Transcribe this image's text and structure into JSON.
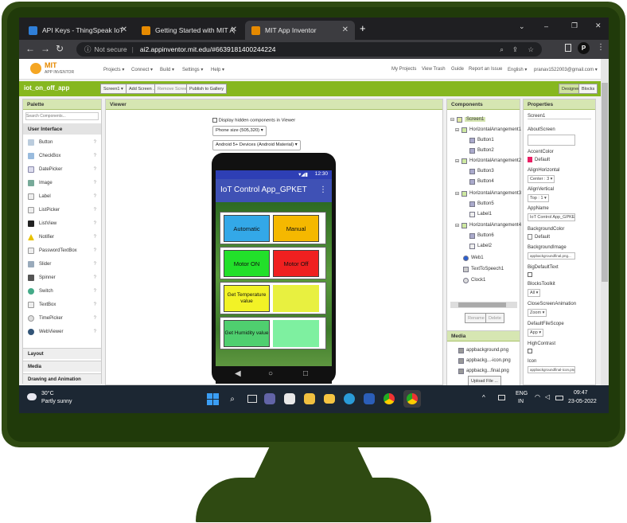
{
  "tabs": [
    {
      "title": "API Keys - ThingSpeak IoT",
      "close": "✕",
      "color": "#2f7fd8"
    },
    {
      "title": "Getting Started with MIT App In",
      "close": "✕",
      "color": "#e68a00"
    },
    {
      "title": "MIT App Inventor",
      "close": "✕",
      "color": "#e68a00"
    }
  ],
  "new_tab": "+",
  "window_controls": [
    "⌄",
    "–",
    "❐",
    "✕"
  ],
  "address": {
    "security": "Not secure",
    "url": "ai2.appinventor.mit.edu/#6639181400244224"
  },
  "browser_profile": "P",
  "logo": {
    "line1": "MIT",
    "line2": "APP INVENTOR"
  },
  "top_menu": [
    "Projects ▾",
    "Connect ▾",
    "Build ▾",
    "Settings ▾",
    "Help ▾"
  ],
  "top_right": [
    "My Projects",
    "View Trash",
    "Guide",
    "Report an Issue",
    "English ▾",
    "pranav1522003@gmail.com ▾"
  ],
  "project": {
    "name": "iot_on_off_app",
    "screen_btn": "Screen1 ▾",
    "add_screen": "Add Screen ...",
    "remove_screen": "Remove Screen",
    "publish": "Publish to Gallery",
    "designer": "Designer",
    "blocks": "Blocks"
  },
  "palette": {
    "title": "Palette",
    "search_placeholder": "Search Components...",
    "category": "User Interface",
    "items": [
      "Button",
      "CheckBox",
      "DatePicker",
      "Image",
      "Label",
      "ListPicker",
      "ListView",
      "Notifier",
      "PasswordTextBox",
      "Slider",
      "Spinner",
      "Switch",
      "TextBox",
      "TimePicker",
      "WebViewer"
    ],
    "help": "?",
    "more_categories": [
      "Layout",
      "Media",
      "Drawing and Animation"
    ]
  },
  "viewer": {
    "title": "Viewer",
    "hidden_label": "Display hidden components in Viewer",
    "phone_size": "Phone size (505,320) ▾",
    "android": "Android 5+ Devices (Android Material) ▾",
    "time": "12:30",
    "app_title": "IoT Control App_GPKET",
    "menu_dots": "⋮",
    "buttons": [
      {
        "label": "Automatic",
        "color": "#33a8e8"
      },
      {
        "label": "Manual",
        "color": "#f5b800"
      },
      {
        "label": "Motor ON",
        "color": "#22e02a"
      },
      {
        "label": "Motor Off",
        "color": "#f02020"
      },
      {
        "label": "Get Temperature value",
        "color": "#f2f226"
      },
      {
        "label": "",
        "color": "#e8f040"
      },
      {
        "label": "Get Humidity value",
        "color": "#4fcf6f"
      },
      {
        "label": "",
        "color": "#7ef0a0"
      }
    ],
    "nav": [
      "◀",
      "○",
      "□"
    ]
  },
  "components": {
    "title": "Components",
    "tree": [
      "Screen1",
      "HorizontalArrangement1",
      "Button1",
      "Button2",
      "HorizontalArrangement2",
      "Button3",
      "Button4",
      "HorizontalArrangement3",
      "Button5",
      "Label1",
      "HorizontalArrangement4",
      "Button6",
      "Label2",
      "Web1",
      "TextToSpeech1",
      "Clock1"
    ],
    "rename": "Rename",
    "delete": "Delete"
  },
  "media": {
    "title": "Media",
    "files": [
      "appbackground.png",
      "appbackg...-icon.png",
      "appbackg...final.png"
    ],
    "upload": "Upload File ..."
  },
  "properties": {
    "title": "Properties",
    "screen": "Screen1",
    "items": [
      {
        "label": "AboutScreen",
        "value": ""
      },
      {
        "label": "AccentColor",
        "value": "Default"
      },
      {
        "label": "AlignHorizontal",
        "value": "Center : 3 ▾"
      },
      {
        "label": "AlignVertical",
        "value": "Top : 1 ▾"
      },
      {
        "label": "AppName",
        "value": "IoT Control App_GPKET"
      },
      {
        "label": "BackgroundColor",
        "value": "Default"
      },
      {
        "label": "BackgroundImage",
        "value": "appbackgroundfinal.png..."
      },
      {
        "label": "BigDefaultText",
        "value": ""
      },
      {
        "label": "BlocksToolkit",
        "value": "All ▾"
      },
      {
        "label": "CloseScreenAnimation",
        "value": "Zoom ▾"
      },
      {
        "label": "DefaultFileScope",
        "value": "App ▾"
      },
      {
        "label": "HighContrast",
        "value": ""
      },
      {
        "label": "Icon",
        "value": "appbackgroundfinal-icon.png"
      }
    ]
  },
  "taskbar": {
    "temp": "30°C",
    "weather": "Partly sunny",
    "lang1": "ENG",
    "lang2": "IN",
    "time": "09:47",
    "date": "23-05-2022",
    "tray": "^"
  }
}
